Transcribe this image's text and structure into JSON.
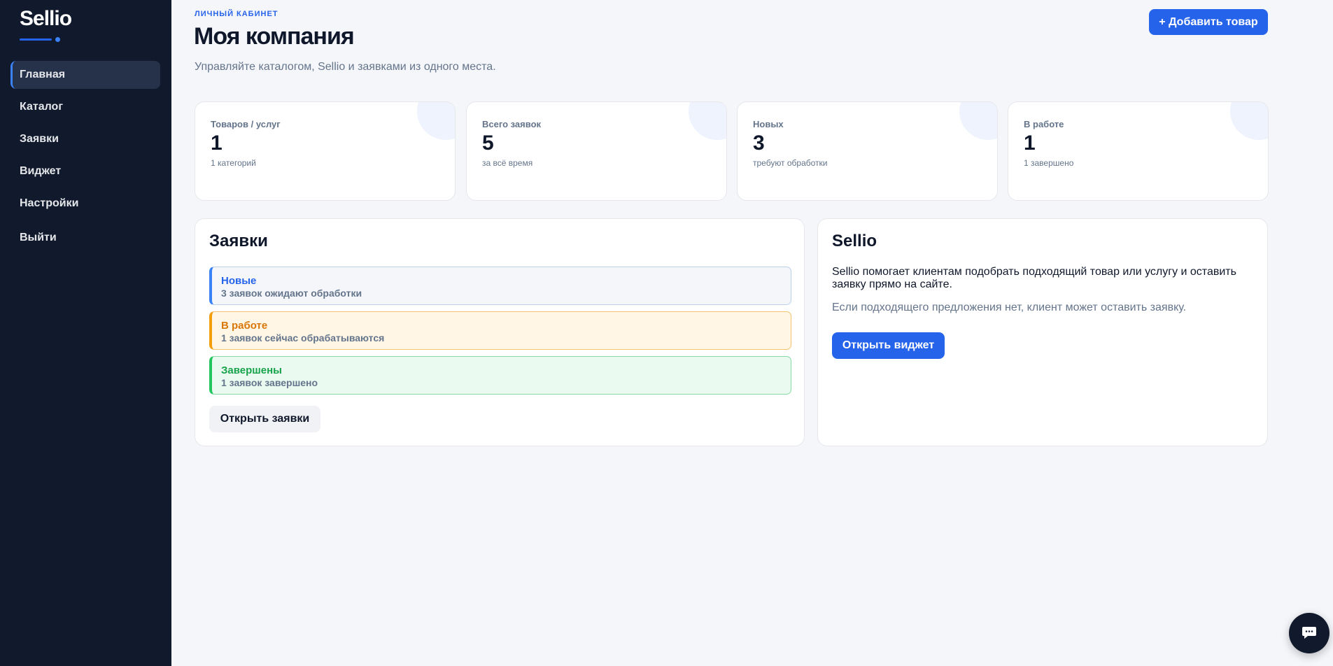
{
  "sidebar": {
    "logo": "Sellio",
    "items": [
      {
        "label": "Главная",
        "active": true
      },
      {
        "label": "Каталог"
      },
      {
        "label": "Заявки"
      },
      {
        "label": "Виджет"
      },
      {
        "label": "Настройки"
      }
    ],
    "logout": "Выйти"
  },
  "header": {
    "eyebrow": "ЛИЧНЫЙ КАБИНЕТ",
    "title": "Моя компания",
    "subtitle": "Управляйте каталогом, Sellio и заявками из одного места.",
    "add_button": "+ Добавить товар"
  },
  "stats": [
    {
      "label": "Товаров / услуг",
      "value": "1",
      "sub": "1 категорий"
    },
    {
      "label": "Всего заявок",
      "value": "5",
      "sub": "за всё время"
    },
    {
      "label": "Новых",
      "value": "3",
      "sub": "требуют обработки"
    },
    {
      "label": "В работе",
      "value": "1",
      "sub": "1 завершено"
    }
  ],
  "requests_panel": {
    "title": "Заявки",
    "statuses": [
      {
        "title": "Новые",
        "desc": "3 заявок ожидают обработки"
      },
      {
        "title": "В работе",
        "desc": "1 заявок сейчас обрабатываются"
      },
      {
        "title": "Завершены",
        "desc": "1 заявок завершено"
      }
    ],
    "open_button": "Открыть заявки"
  },
  "info_panel": {
    "title": "Sellio",
    "text1": "Sellio помогает клиентам подобрать подходящий товар или услугу и оставить заявку прямо на сайте.",
    "text2": "Если подходящего предложения нет, клиент может оставить заявку.",
    "open_button": "Открыть виджет"
  },
  "chat": {
    "icon": "chat-bubble-icon"
  },
  "colors": {
    "sidebar_bg": "#111a2c",
    "accent": "#2563eb",
    "new": "#3b82f6",
    "in_progress": "#f59e0b",
    "done": "#22c55e"
  }
}
